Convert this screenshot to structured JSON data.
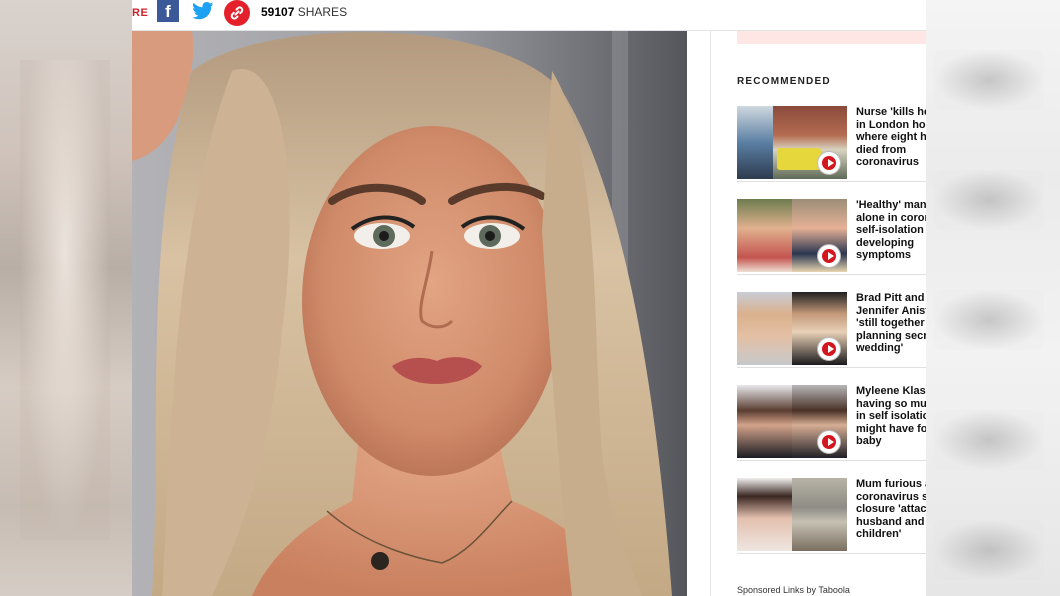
{
  "share_bar": {
    "label_fragment": "RE",
    "count": "59107",
    "count_suffix": "SHARES",
    "icons": [
      "facebook-icon",
      "twitter-icon",
      "link-icon"
    ],
    "colors": {
      "facebook": "#3b5998",
      "twitter": "#1da1f2",
      "link": "#e4212b"
    }
  },
  "hero_image": {
    "subject": "selfie-portrait"
  },
  "sidebar": {
    "recommended_title": "RECOMMENDED",
    "items": [
      {
        "text": "Nurse 'kills he\nin London hos\nwhere eight ha\ndied from\ncoronavirus"
      },
      {
        "text": "'Healthy' man\nalone in coron\nself-isolation a\ndeveloping\nsymptoms"
      },
      {
        "text": "Brad Pitt and\nJennifer Anisto\n'still together\nplanning secre\nwedding'"
      },
      {
        "text": "Myleene Klass\nhaving so muc\nin self isolatio\nmight have fo\nbaby"
      },
      {
        "text": "Mum furious a\ncoronavirus sc\nclosure 'attack\nhusband and\nchildren'"
      }
    ],
    "sponsored": "Sponsored Links by Taboola"
  },
  "accent": "#cc2229"
}
